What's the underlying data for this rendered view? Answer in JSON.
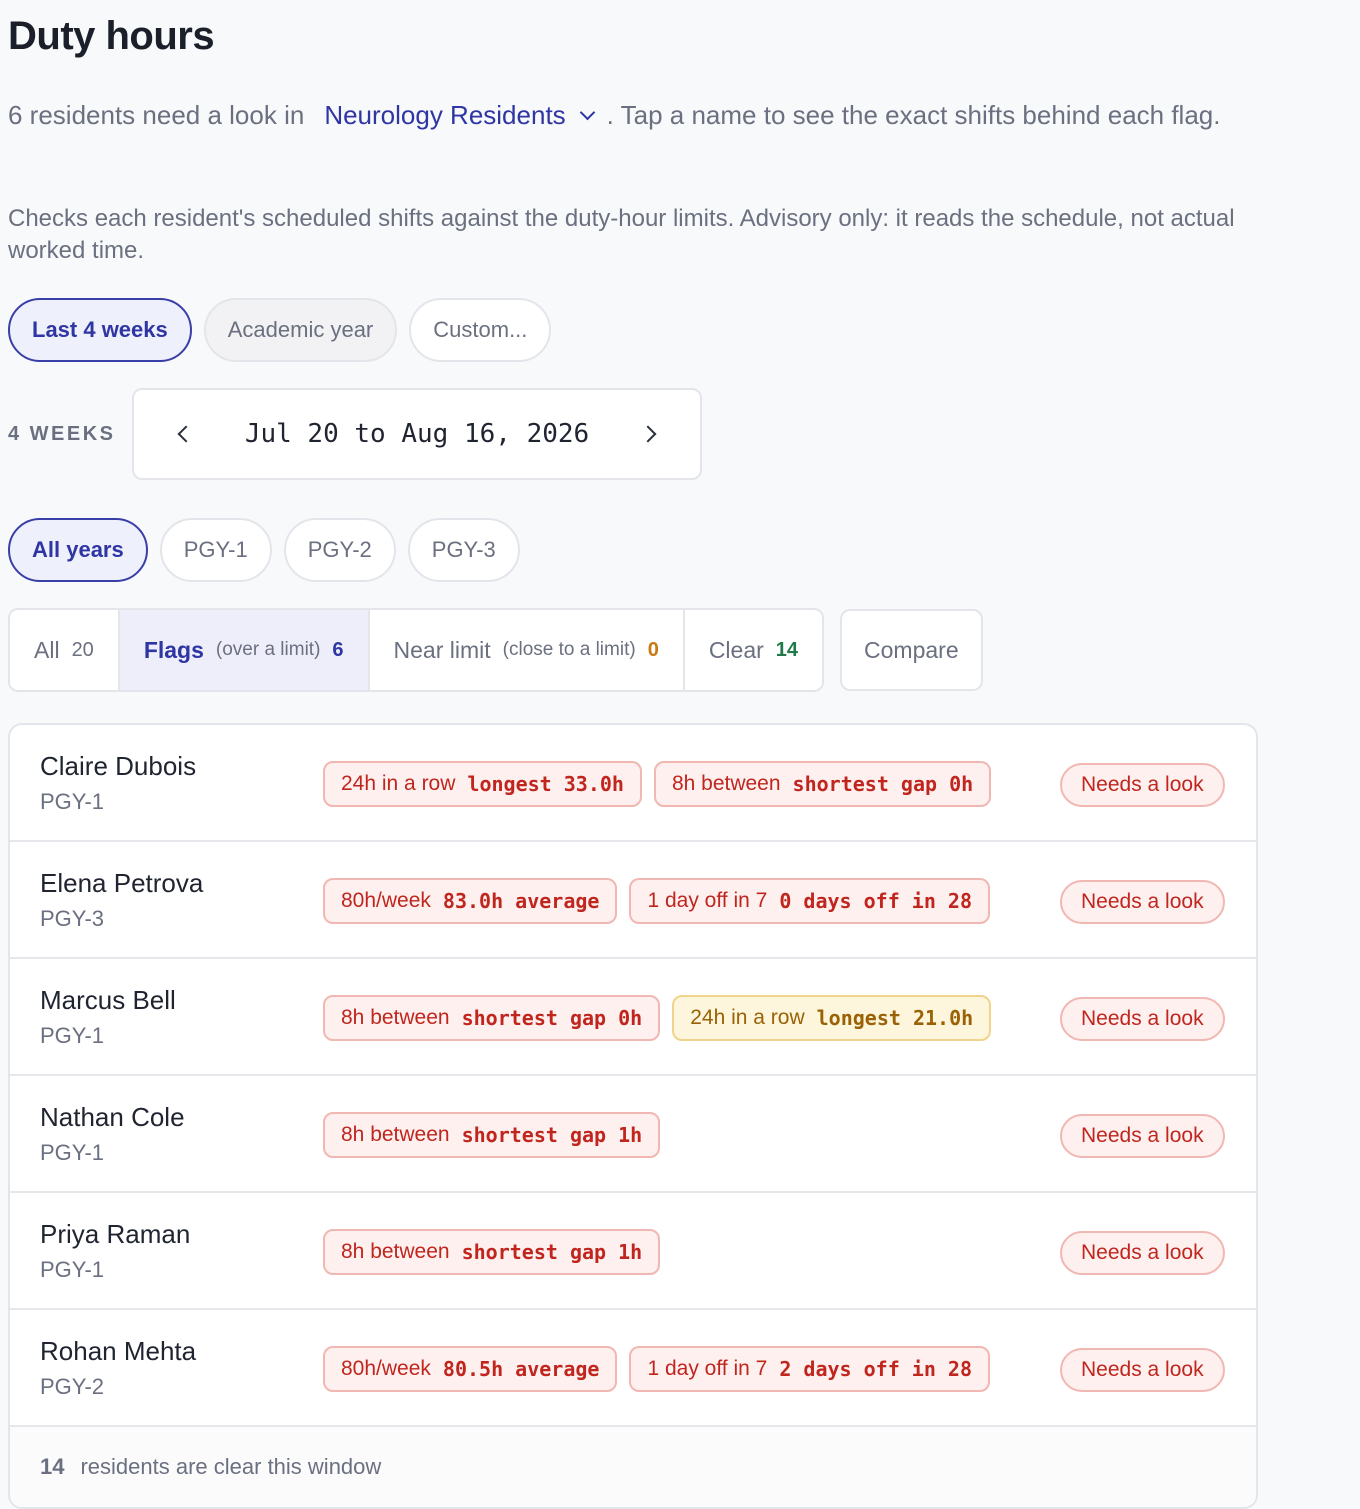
{
  "page": {
    "title": "Duty hours",
    "subtitle_prefix": "6 residents need a look in",
    "group_name": "Neurology Residents",
    "subtitle_suffix": ". Tap a name to see the exact shifts behind each flag.",
    "description": "Checks each resident's scheduled shifts against the duty-hour limits. Advisory only: it reads the schedule, not actual worked time."
  },
  "range_presets": [
    {
      "label": "Last 4 weeks"
    },
    {
      "label": "Academic year"
    },
    {
      "label": "Custom..."
    }
  ],
  "range": {
    "span_label": "4 WEEKS",
    "text": "Jul 20 to Aug 16, 2026"
  },
  "year_filters": [
    {
      "label": "All years"
    },
    {
      "label": "PGY-1"
    },
    {
      "label": "PGY-2"
    },
    {
      "label": "PGY-3"
    }
  ],
  "tabs": {
    "all": {
      "label": "All",
      "count": "20"
    },
    "flags": {
      "label": "Flags",
      "sub": "(over a limit)",
      "count": "6"
    },
    "near": {
      "label": "Near limit",
      "sub": "(close to a limit)",
      "count": "0"
    },
    "clear": {
      "label": "Clear",
      "count": "14"
    },
    "compare_label": "Compare"
  },
  "residents": [
    {
      "name": "Claire Dubois",
      "year": "PGY-1",
      "chips": [
        {
          "rule": "24h in a row",
          "value": "longest 33.0h"
        },
        {
          "rule": "8h between",
          "value": "shortest gap 0h"
        }
      ],
      "status": "Needs a look"
    },
    {
      "name": "Elena Petrova",
      "year": "PGY-3",
      "chips": [
        {
          "rule": "80h/week",
          "value": "83.0h average"
        },
        {
          "rule": "1 day off in 7",
          "value": "0 days off in 28"
        }
      ],
      "status": "Needs a look"
    },
    {
      "name": "Marcus Bell",
      "year": "PGY-1",
      "chips": [
        {
          "rule": "8h between",
          "value": "shortest gap 0h"
        },
        {
          "rule": "24h in a row",
          "value": "longest 21.0h"
        }
      ],
      "status": "Needs a look"
    },
    {
      "name": "Nathan Cole",
      "year": "PGY-1",
      "chips": [
        {
          "rule": "8h between",
          "value": "shortest gap 1h"
        }
      ],
      "status": "Needs a look"
    },
    {
      "name": "Priya Raman",
      "year": "PGY-1",
      "chips": [
        {
          "rule": "8h between",
          "value": "shortest gap 1h"
        }
      ],
      "status": "Needs a look"
    },
    {
      "name": "Rohan Mehta",
      "year": "PGY-2",
      "chips": [
        {
          "rule": "80h/week",
          "value": "80.5h average"
        },
        {
          "rule": "1 day off in 7",
          "value": "2 days off in 28"
        }
      ],
      "status": "Needs a look"
    }
  ],
  "footer": {
    "clear_count": "14",
    "text": "residents are clear this window"
  },
  "colors": {
    "accent": "#2f35a3",
    "flag_red": "#c0261e",
    "near_amber": "#9a6204",
    "clear_green": "#1f7a4a"
  }
}
